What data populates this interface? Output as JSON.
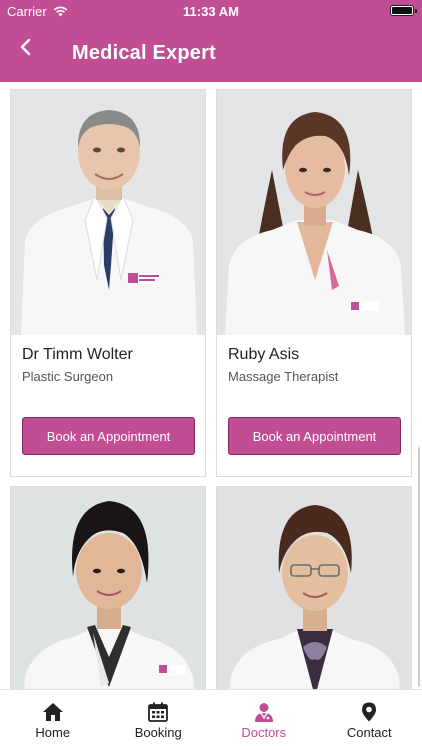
{
  "status_bar": {
    "carrier": "Carrier",
    "time": "11:33 AM",
    "battery_level": 1.0
  },
  "header": {
    "title": "Medical Expert"
  },
  "colors": {
    "brand": "#c14e95",
    "brand_dark": "#7a2c5c",
    "tab_active": "#c14e95"
  },
  "doctors": [
    {
      "name": "Dr Timm Wolter",
      "role": "Plastic Surgeon",
      "button_label": "Book an Appointment"
    },
    {
      "name": "Ruby Asis",
      "role": "Massage Therapist",
      "button_label": "Book an Appointment"
    }
  ],
  "tabs": [
    {
      "label": "Home",
      "icon": "home-icon",
      "active": false
    },
    {
      "label": "Booking",
      "icon": "calendar-icon",
      "active": false
    },
    {
      "label": "Doctors",
      "icon": "doctor-icon",
      "active": true
    },
    {
      "label": "Contact",
      "icon": "location-pin-icon",
      "active": false
    }
  ]
}
